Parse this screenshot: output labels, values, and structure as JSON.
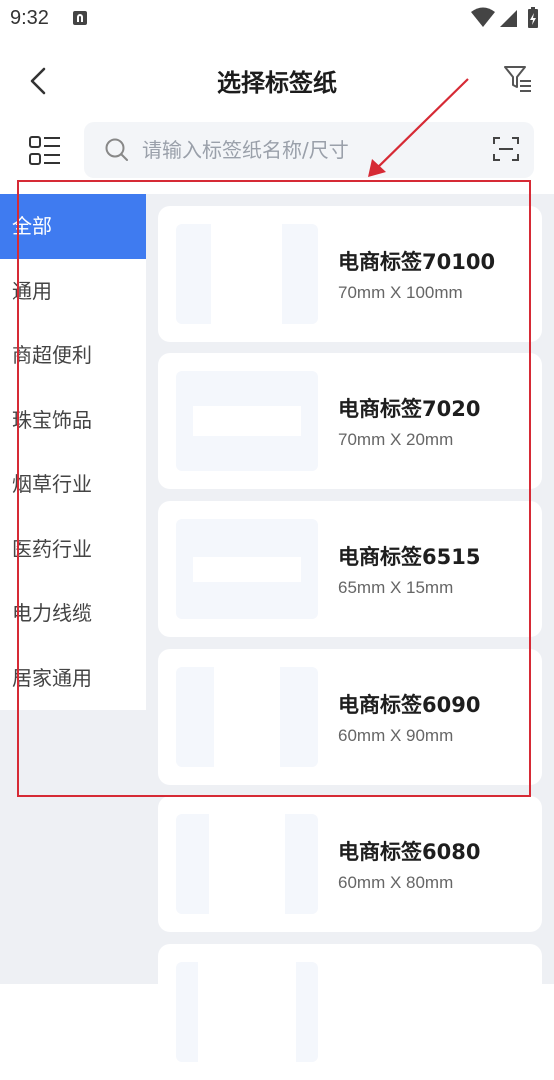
{
  "status_bar": {
    "time": "9:32"
  },
  "header": {
    "title": "选择标签纸"
  },
  "search": {
    "placeholder": "请输入标签纸名称/尺寸"
  },
  "sidebar": {
    "items": [
      {
        "label": "全部",
        "active": true
      },
      {
        "label": "通用"
      },
      {
        "label": "商超便利"
      },
      {
        "label": "珠宝饰品"
      },
      {
        "label": "烟草行业"
      },
      {
        "label": "医药行业"
      },
      {
        "label": "电力线缆"
      },
      {
        "label": "居家通用"
      }
    ]
  },
  "labels": [
    {
      "name": "电商标签70100",
      "size": "70mm X 100mm",
      "orientation": "portrait"
    },
    {
      "name": "电商标签7020",
      "size": "70mm X 20mm",
      "orientation": "landscape"
    },
    {
      "name": "电商标签6515",
      "size": "65mm X 15mm",
      "orientation": "landscape"
    },
    {
      "name": "电商标签6090",
      "size": "60mm X 90mm",
      "orientation": "portrait"
    },
    {
      "name": "电商标签6080",
      "size": "60mm X 80mm",
      "orientation": "portrait"
    }
  ],
  "colors": {
    "accent": "#3f7bf0",
    "annotation": "#d62a35",
    "background": "#eef0f4"
  }
}
